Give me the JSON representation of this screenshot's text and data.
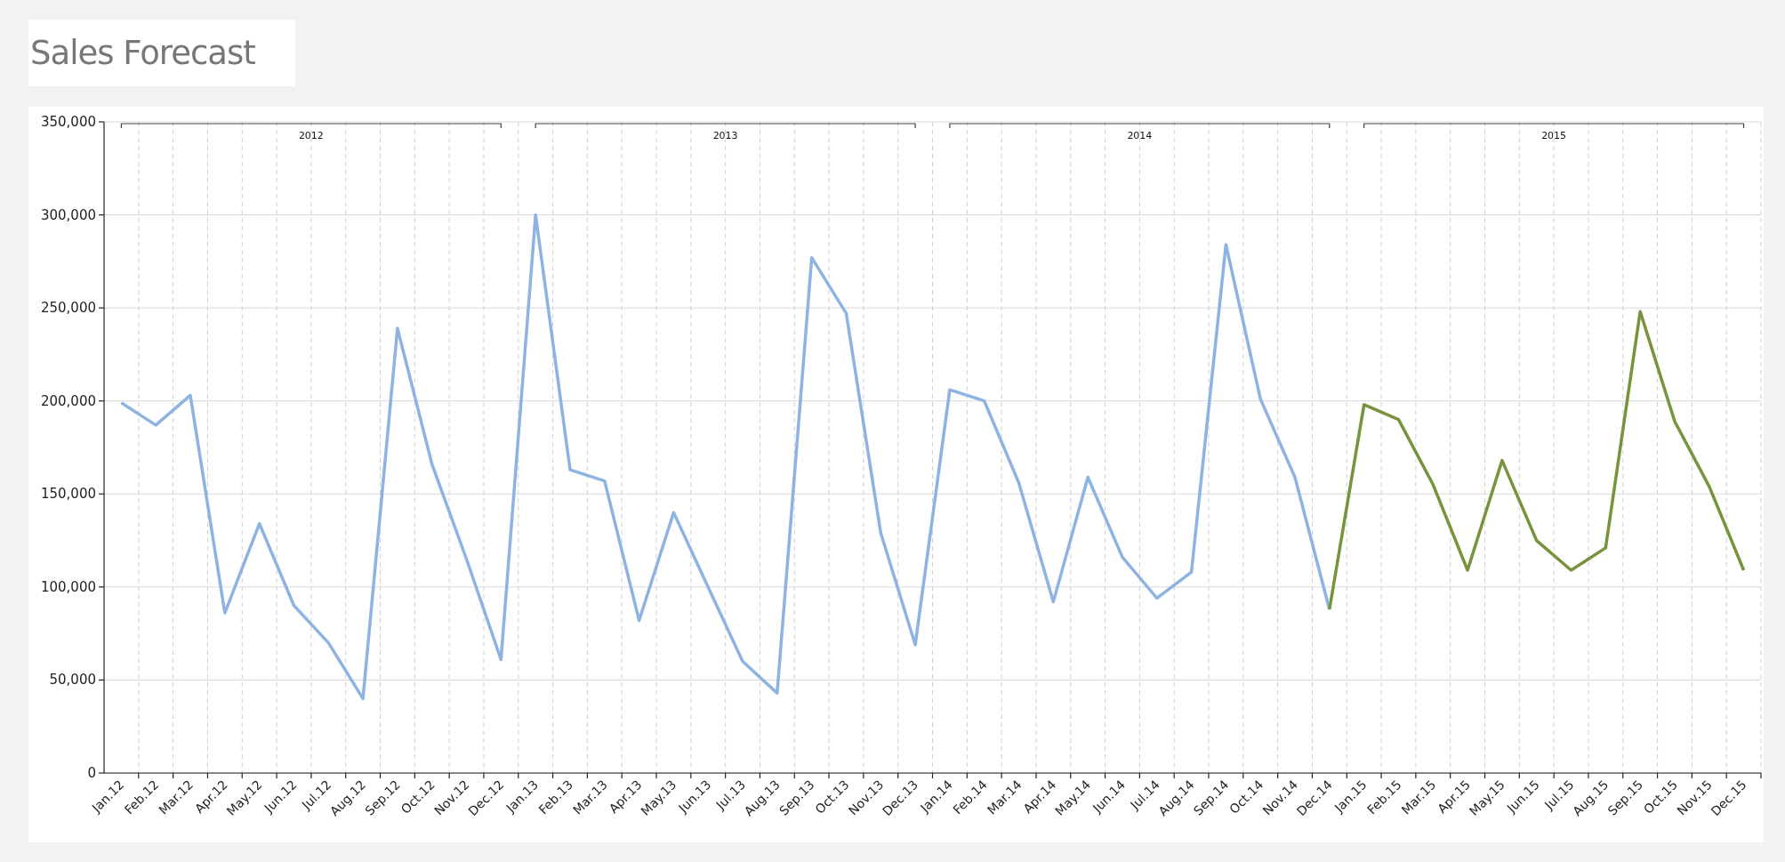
{
  "title": "Sales Forecast",
  "chart": {
    "chart_data": {
      "type": "line",
      "categories": [
        "Jan.12",
        "Feb.12",
        "Mar.12",
        "Apr.12",
        "May.12",
        "Jun.12",
        "Jul.12",
        "Aug.12",
        "Sep.12",
        "Oct.12",
        "Nov.12",
        "Dec.12",
        "Jan.13",
        "Feb.13",
        "Mar.13",
        "Apr.13",
        "May.13",
        "Jun.13",
        "Jul.13",
        "Aug.13",
        "Sep.13",
        "Oct.13",
        "Nov.13",
        "Dec.13",
        "Jan.14",
        "Feb.14",
        "Mar.14",
        "Apr.14",
        "May.14",
        "Jun.14",
        "Jul.14",
        "Aug.14",
        "Sep.14",
        "Oct.14",
        "Nov.14",
        "Dec.14",
        "Jan.15",
        "Feb.15",
        "Mar.15",
        "Apr.15",
        "May.15",
        "Jun.15",
        "Jul.15",
        "Aug.15",
        "Sep.15",
        "Oct.15",
        "Nov.15",
        "Dec.15"
      ],
      "series": [
        {
          "color": "#8db3e2",
          "values": [
            199000,
            187000,
            203000,
            86000,
            134000,
            90000,
            70000,
            40000,
            239000,
            166000,
            115000,
            61000,
            300000,
            163000,
            157000,
            82000,
            140000,
            100000,
            60000,
            43000,
            277000,
            247000,
            129000,
            69000,
            206000,
            200000,
            156000,
            92000,
            159000,
            116000,
            94000,
            108000,
            284000,
            201000,
            159000,
            88000,
            null,
            null,
            null,
            null,
            null,
            null,
            null,
            null,
            null,
            null,
            null,
            null
          ]
        },
        {
          "color": "#77933c",
          "values": [
            null,
            null,
            null,
            null,
            null,
            null,
            null,
            null,
            null,
            null,
            null,
            null,
            null,
            null,
            null,
            null,
            null,
            null,
            null,
            null,
            null,
            null,
            null,
            null,
            null,
            null,
            null,
            null,
            null,
            null,
            null,
            null,
            null,
            null,
            null,
            88000,
            198000,
            190000,
            155000,
            109000,
            168000,
            125000,
            109000,
            121000,
            248000,
            189000,
            154000,
            109000
          ]
        }
      ],
      "ylim": [
        0,
        350000
      ],
      "yticks": [
        {
          "value": 0,
          "label": "0"
        },
        {
          "value": 50000,
          "label": "50,000"
        },
        {
          "value": 100000,
          "label": "100,000"
        },
        {
          "value": 150000,
          "label": "150,000"
        },
        {
          "value": 200000,
          "label": "200,000"
        },
        {
          "value": 250000,
          "label": "250,000"
        },
        {
          "value": 300000,
          "label": "300,000"
        },
        {
          "value": 350000,
          "label": "350,000"
        }
      ],
      "annotations": [
        "2012",
        "2013",
        "2014",
        "2015"
      ],
      "grid": true
    }
  }
}
